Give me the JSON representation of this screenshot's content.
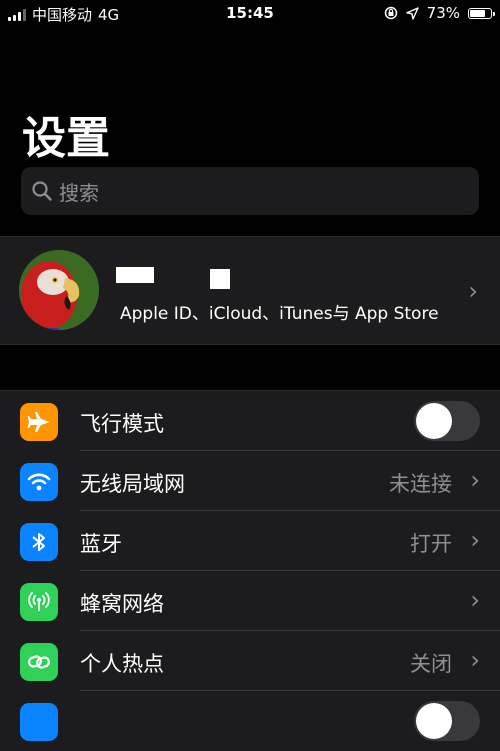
{
  "status_bar": {
    "carrier": "中国移动",
    "network": "4G",
    "time": "15:45",
    "battery": "73%",
    "battery_level": 0.73,
    "icons": [
      "signal-bars-icon",
      "orientation-lock-icon",
      "location-arrow-icon",
      "battery-icon"
    ]
  },
  "page": {
    "title": "设置",
    "search_placeholder": "搜索"
  },
  "profile": {
    "subtitle": "Apple ID、iCloud、iTunes与 App Store"
  },
  "settings": [
    {
      "label": "飞行模式",
      "type": "toggle",
      "on": false,
      "icon": "airplane-icon",
      "color": "#ff9500"
    },
    {
      "label": "无线局域网",
      "type": "value",
      "value": "未连接",
      "icon": "wifi-icon",
      "color": "#0a84ff"
    },
    {
      "label": "蓝牙",
      "type": "value",
      "value": "打开",
      "icon": "bluetooth-icon",
      "color": "#0a84ff"
    },
    {
      "label": "蜂窝网络",
      "type": "link",
      "icon": "cellular-icon",
      "color": "#30d158"
    },
    {
      "label": "个人热点",
      "type": "value",
      "value": "关闭",
      "icon": "hotspot-icon",
      "color": "#30d158"
    }
  ],
  "colors": {
    "background": "#000000",
    "cell": "#1c1c1e",
    "secondary_text": "#8e8e93"
  }
}
